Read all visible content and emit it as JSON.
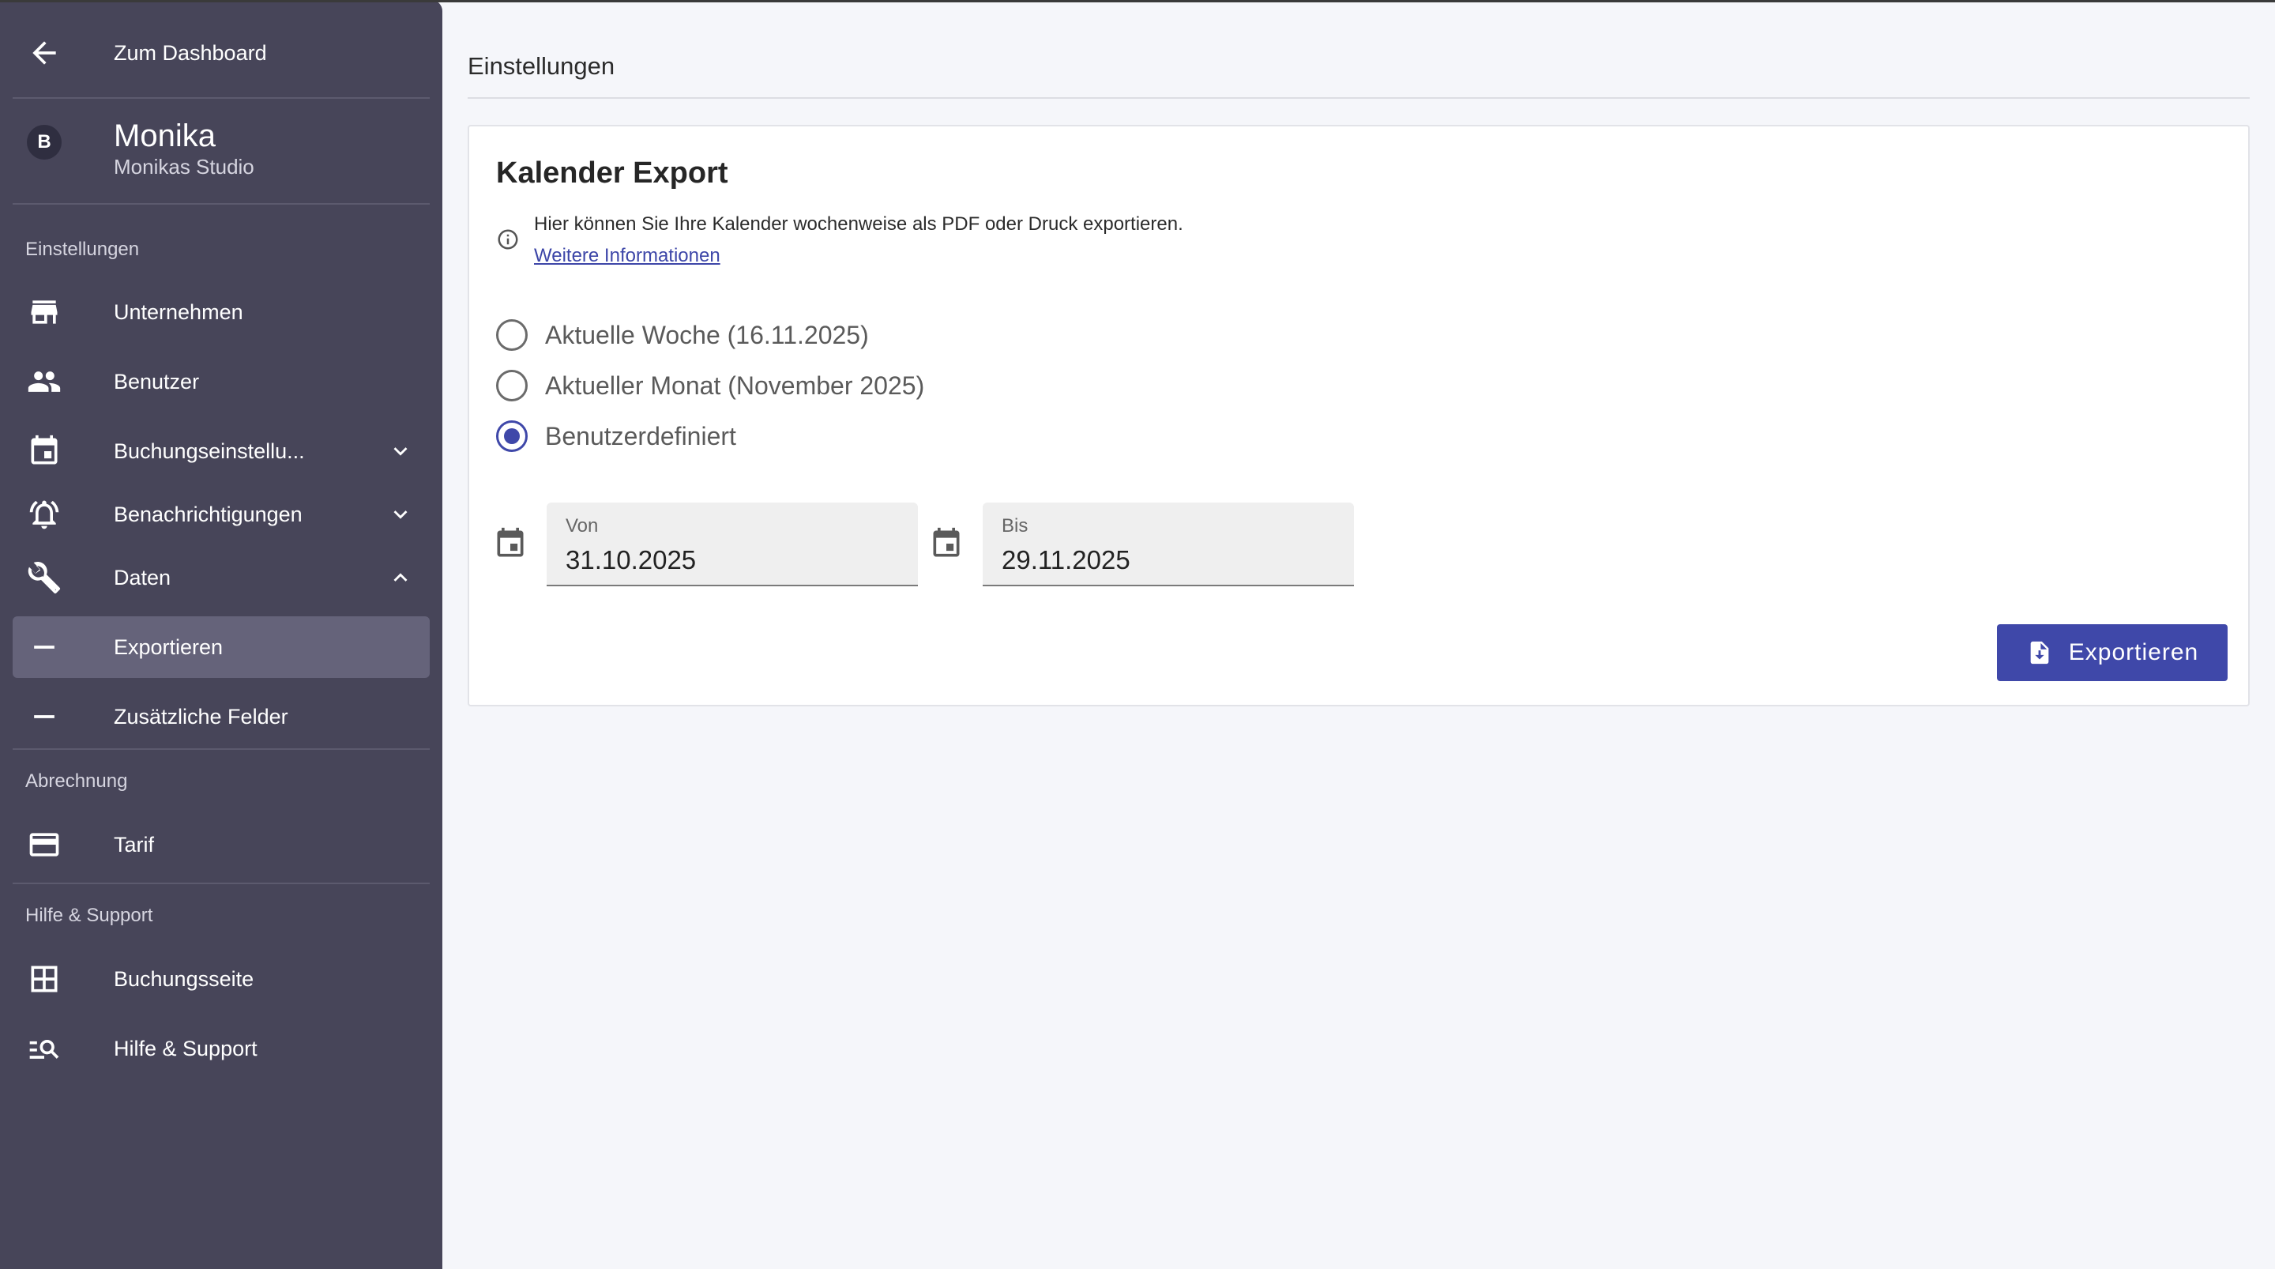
{
  "sidebar": {
    "back_label": "Zum Dashboard",
    "profile": {
      "initial": "B",
      "name": "Monika",
      "studio": "Monikas Studio"
    },
    "sections": {
      "settings": "Einstellungen",
      "billing": "Abrechnung",
      "help": "Hilfe & Support"
    },
    "items": {
      "company": "Unternehmen",
      "users": "Benutzer",
      "booking_settings": "Buchungseinstellu...",
      "notifications": "Benachrichtigungen",
      "data": "Daten",
      "export": "Exportieren",
      "extra_fields": "Zusätzliche Felder",
      "plan": "Tarif",
      "booking_page": "Buchungsseite",
      "help_support": "Hilfe & Support"
    }
  },
  "main": {
    "page_title": "Einstellungen",
    "card": {
      "title": "Kalender Export",
      "info_text": "Hier können Sie Ihre Kalender wochenweise als PDF oder Druck exportieren.",
      "info_link": "Weitere Informationen",
      "options": [
        {
          "label": "Aktuelle Woche (16.11.2025)",
          "checked": false
        },
        {
          "label": "Aktueller Monat (November 2025)",
          "checked": false
        },
        {
          "label": "Benutzerdefiniert",
          "checked": true
        }
      ],
      "from": {
        "label": "Von",
        "value": "31.10.2025"
      },
      "to": {
        "label": "Bis",
        "value": "29.11.2025"
      },
      "export_button": "Exportieren"
    }
  },
  "colors": {
    "sidebar_bg": "#474559",
    "sidebar_active": "#65637a",
    "accent": "#3f48a9"
  }
}
